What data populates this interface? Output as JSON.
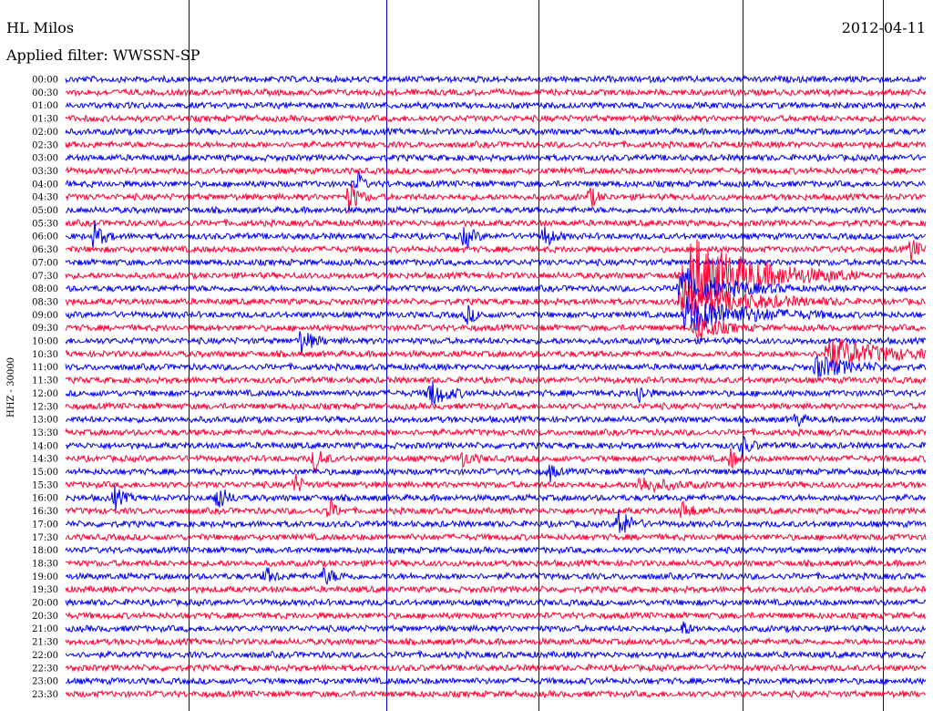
{
  "header": {
    "station": "HL Milos",
    "date": "2012-04-11",
    "filter_text": "Applied filter: WWSSN-SP"
  },
  "chart_data": {
    "type": "helicorder",
    "channel_label": "HHZ - 30000",
    "row_labels": [
      "00:00",
      "00:30",
      "01:00",
      "01:30",
      "02:00",
      "02:30",
      "03:00",
      "03:30",
      "04:00",
      "04:30",
      "05:00",
      "05:30",
      "06:00",
      "06:30",
      "07:00",
      "07:30",
      "08:00",
      "08:30",
      "09:00",
      "09:30",
      "10:00",
      "10:30",
      "11:00",
      "11:30",
      "12:00",
      "12:30",
      "13:00",
      "13:30",
      "14:00",
      "14:30",
      "15:00",
      "15:30",
      "16:00",
      "16:30",
      "17:00",
      "17:30",
      "18:00",
      "18:30",
      "19:00",
      "19:30",
      "20:00",
      "20:30",
      "21:00",
      "21:30",
      "22:00",
      "22:30",
      "23:00",
      "23:30"
    ],
    "series_colors": [
      "#0000ee",
      "#ff0033"
    ],
    "minute_markers": [
      4.3,
      11.2,
      16.5,
      23.6,
      28.5
    ],
    "events": [
      {
        "row": 9,
        "minute": 9.9,
        "amp": 3.0,
        "dur": 0.8
      },
      {
        "row": 9,
        "minute": 18.3,
        "amp": 2.0,
        "dur": 0.6
      },
      {
        "row": 8,
        "minute": 10.2,
        "amp": 2.5,
        "dur": 0.4
      },
      {
        "row": 12,
        "minute": 1.0,
        "amp": 2.6,
        "dur": 0.8
      },
      {
        "row": 12,
        "minute": 13.9,
        "amp": 2.2,
        "dur": 0.8
      },
      {
        "row": 12,
        "minute": 16.7,
        "amp": 2.0,
        "dur": 0.8
      },
      {
        "row": 13,
        "minute": 29.5,
        "amp": 2.4,
        "dur": 0.6
      },
      {
        "row": 15,
        "minute": 21.6,
        "amp": 8.0,
        "dur": 6.0
      },
      {
        "row": 16,
        "minute": 21.4,
        "amp": 4.0,
        "dur": 4.0
      },
      {
        "row": 17,
        "minute": 21.5,
        "amp": 3.2,
        "dur": 6.0
      },
      {
        "row": 18,
        "minute": 21.6,
        "amp": 3.2,
        "dur": 5.5
      },
      {
        "row": 18,
        "minute": 14.0,
        "amp": 1.6,
        "dur": 0.8
      },
      {
        "row": 19,
        "minute": 22.0,
        "amp": 2.6,
        "dur": 2.0
      },
      {
        "row": 20,
        "minute": 8.2,
        "amp": 2.4,
        "dur": 1.0
      },
      {
        "row": 21,
        "minute": 26.5,
        "amp": 3.0,
        "dur": 5.0
      },
      {
        "row": 22,
        "minute": 26.2,
        "amp": 2.0,
        "dur": 3.0
      },
      {
        "row": 24,
        "minute": 12.7,
        "amp": 2.6,
        "dur": 1.5
      },
      {
        "row": 24,
        "minute": 20.0,
        "amp": 2.0,
        "dur": 0.6
      },
      {
        "row": 26,
        "minute": 25.5,
        "amp": 1.4,
        "dur": 0.5
      },
      {
        "row": 28,
        "minute": 23.6,
        "amp": 1.8,
        "dur": 0.8
      },
      {
        "row": 29,
        "minute": 8.7,
        "amp": 2.6,
        "dur": 0.7
      },
      {
        "row": 29,
        "minute": 23.2,
        "amp": 1.8,
        "dur": 0.6
      },
      {
        "row": 29,
        "minute": 13.8,
        "amp": 1.4,
        "dur": 1.0
      },
      {
        "row": 30,
        "minute": 16.9,
        "amp": 1.6,
        "dur": 0.5
      },
      {
        "row": 31,
        "minute": 8.0,
        "amp": 2.0,
        "dur": 0.6
      },
      {
        "row": 31,
        "minute": 20.0,
        "amp": 1.4,
        "dur": 2.5
      },
      {
        "row": 32,
        "minute": 1.7,
        "amp": 2.0,
        "dur": 0.8
      },
      {
        "row": 32,
        "minute": 5.3,
        "amp": 2.6,
        "dur": 0.8
      },
      {
        "row": 33,
        "minute": 9.2,
        "amp": 2.2,
        "dur": 0.6
      },
      {
        "row": 33,
        "minute": 21.5,
        "amp": 1.6,
        "dur": 1.0
      },
      {
        "row": 34,
        "minute": 19.3,
        "amp": 3.0,
        "dur": 1.0
      },
      {
        "row": 38,
        "minute": 9.0,
        "amp": 1.4,
        "dur": 1.2
      },
      {
        "row": 38,
        "minute": 7.0,
        "amp": 1.4,
        "dur": 0.8
      },
      {
        "row": 42,
        "minute": 21.5,
        "amp": 1.6,
        "dur": 0.6
      }
    ]
  }
}
